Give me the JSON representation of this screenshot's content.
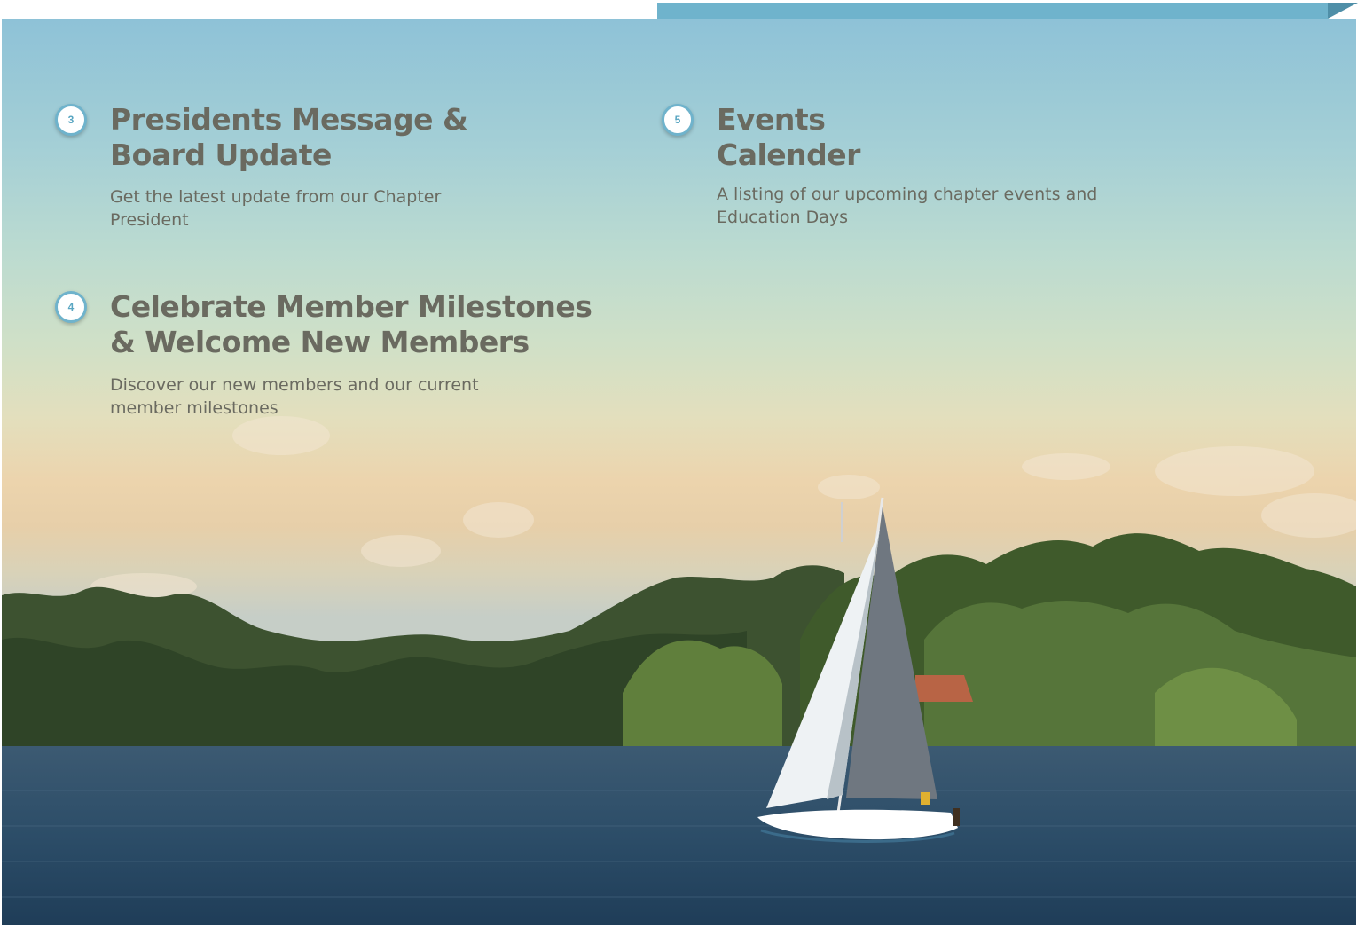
{
  "theme": {
    "accent": "#6fb3cc",
    "text": "#6a6a60"
  },
  "items": [
    {
      "number": "3",
      "title_lines": [
        "Presidents Message &",
        "Board Update"
      ],
      "description": "Get the latest update from our Chapter President"
    },
    {
      "number": "4",
      "title_lines": [
        "Celebrate Member Milestones",
        "& Welcome New Members"
      ],
      "description": "Discover our new members and our current member milestones"
    },
    {
      "number": "5",
      "title_lines": [
        "Events",
        "Calender"
      ],
      "description": "A listing of our upcoming chapter events and Education Days"
    }
  ],
  "background": {
    "subject": "sailboat on a lake with wooded shoreline at sunset"
  }
}
